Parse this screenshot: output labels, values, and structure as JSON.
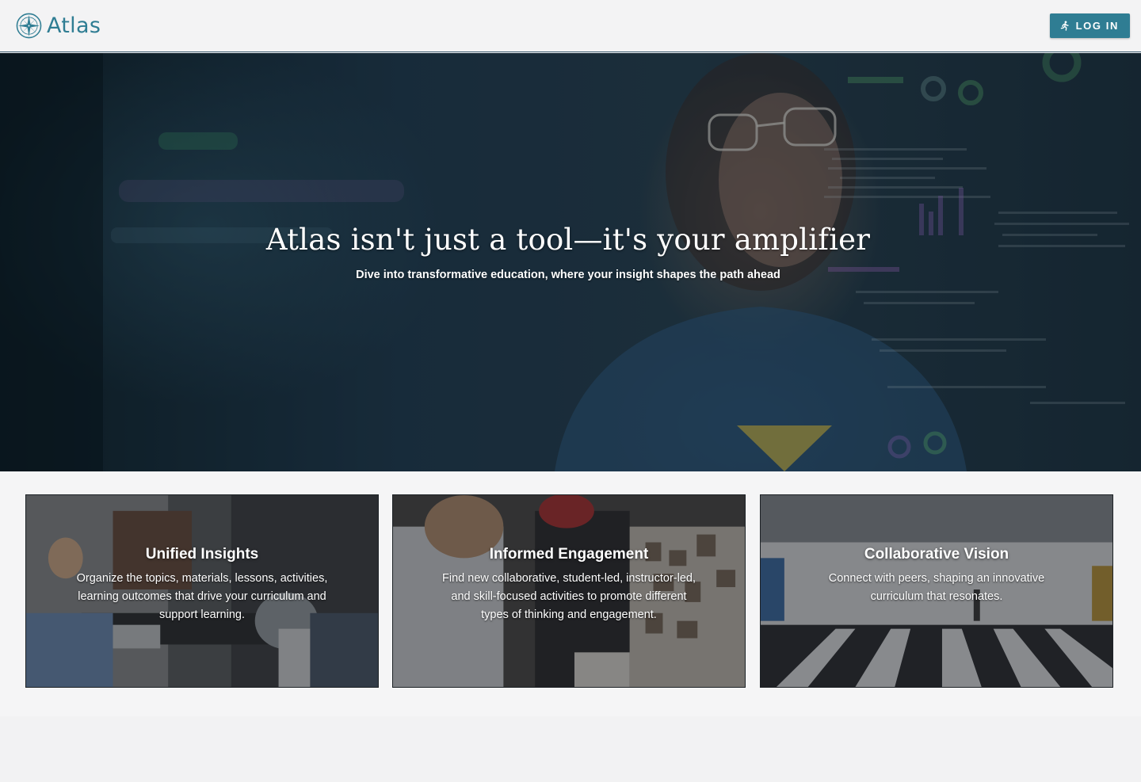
{
  "header": {
    "brand_name": "Atlas",
    "login_label": "LOG IN",
    "logo_icon": "compass-rose-icon",
    "login_icon": "running-person-icon"
  },
  "hero": {
    "title": "Atlas isn't just a tool—it's your amplifier",
    "subtitle": "Dive into transformative education, where your insight shapes the path ahead"
  },
  "cards": [
    {
      "title": "Unified Insights",
      "description": "Organize the topics, materials, lessons, activities, learning outcomes that drive your curriculum and support learning."
    },
    {
      "title": "Informed Engagement",
      "description": "Find new collaborative, student-led, instructor-led, and skill-focused activities to promote different types of thinking and engagement."
    },
    {
      "title": "Collaborative Vision",
      "description": "Connect with peers, shaping an innovative curriculum that resonates."
    }
  ],
  "colors": {
    "brand": "#2f7d93",
    "header_bg": "#f3f3f4",
    "page_bg": "#f5f5f6"
  }
}
